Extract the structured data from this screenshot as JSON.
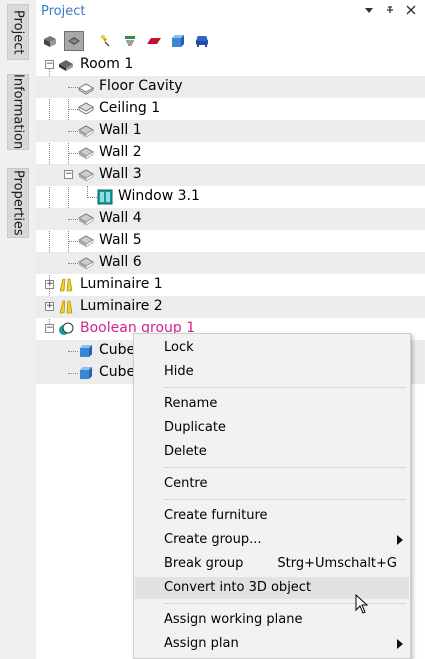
{
  "side_tabs": [
    "Project",
    "Information",
    "Properties"
  ],
  "panel": {
    "title": "Project",
    "icons": [
      "dropdown-arrow-icon",
      "pin-icon",
      "close-icon"
    ]
  },
  "toolbar": [
    "view-3d-icon",
    "view-plan-icon",
    "luminaire-icon",
    "sensor-icon",
    "surface-icon",
    "cube-icon",
    "furniture-icon"
  ],
  "tree": [
    {
      "label": "Room 1",
      "icon": "room-icon"
    },
    {
      "label": "Floor Cavity",
      "icon": "surface-icon"
    },
    {
      "label": "Ceiling 1",
      "icon": "surface-icon"
    },
    {
      "label": "Wall 1",
      "icon": "surface-icon"
    },
    {
      "label": "Wall 2",
      "icon": "surface-icon"
    },
    {
      "label": "Wall 3",
      "icon": "surface-icon"
    },
    {
      "label": "Window 3.1",
      "icon": "window-icon"
    },
    {
      "label": "Wall 4",
      "icon": "surface-icon"
    },
    {
      "label": "Wall 5",
      "icon": "surface-icon"
    },
    {
      "label": "Wall 6",
      "icon": "surface-icon"
    },
    {
      "label": "Luminaire  1",
      "icon": "luminaire-icon"
    },
    {
      "label": "Luminaire  2",
      "icon": "luminaire-icon"
    },
    {
      "label": "Boolean group 1",
      "icon": "boolean-group-icon",
      "color": "#d4238c"
    },
    {
      "label": "Cube",
      "icon": "cube-icon"
    },
    {
      "label": "Cube",
      "icon": "cube-icon"
    }
  ],
  "context_menu": {
    "items": [
      {
        "label": "Lock"
      },
      {
        "label": "Hide"
      },
      {
        "label": "Rename"
      },
      {
        "label": "Duplicate"
      },
      {
        "label": "Delete"
      },
      {
        "label": "Centre"
      },
      {
        "label": "Create furniture"
      },
      {
        "label": "Create group...",
        "submenu": true
      },
      {
        "label": "Break group",
        "shortcut": "Strg+Umschalt+G"
      },
      {
        "label": "Convert into 3D object",
        "highlighted": true
      },
      {
        "label": "Assign working plane"
      },
      {
        "label": "Assign plan",
        "submenu": true
      }
    ]
  },
  "colors": {
    "accent": "#3a78c9",
    "boolean_group": "#d4238c",
    "window": "#1b9a9a",
    "cube": "#3d86d6"
  }
}
